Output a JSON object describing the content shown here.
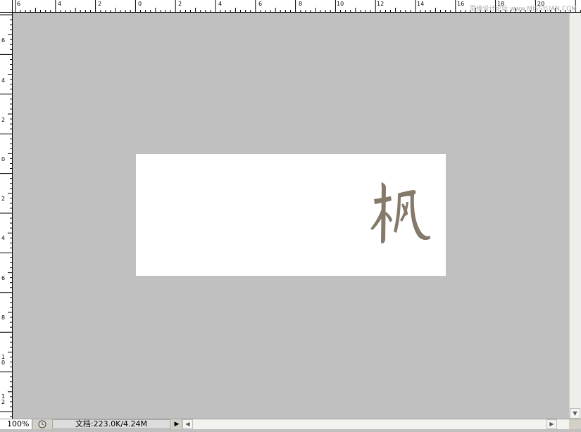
{
  "rulers": {
    "horizontal_labels": [
      "6",
      "4",
      "2",
      "0",
      "2",
      "4",
      "6",
      "8",
      "10",
      "12",
      "14",
      "16",
      "18",
      "20"
    ],
    "vertical_labels": [
      "6",
      "4",
      "2",
      "0",
      "2",
      "4",
      "6",
      "8",
      "10",
      "12"
    ]
  },
  "watermark": "思缘设计论坛 www.MISSYUAN.COM",
  "canvas": {
    "background": "#ffffff",
    "glyph_color": "#85796a",
    "glyph_text": "枫"
  },
  "statusbar": {
    "zoom": "100%",
    "doc_info": "文档:223.0K/4.24M"
  },
  "icons": {
    "status_menu": "clock-icon",
    "expand": "play-arrow-icon",
    "scroll_left": "chevron-left-icon",
    "scroll_right": "chevron-right-icon",
    "scroll_down": "chevron-down-icon"
  }
}
